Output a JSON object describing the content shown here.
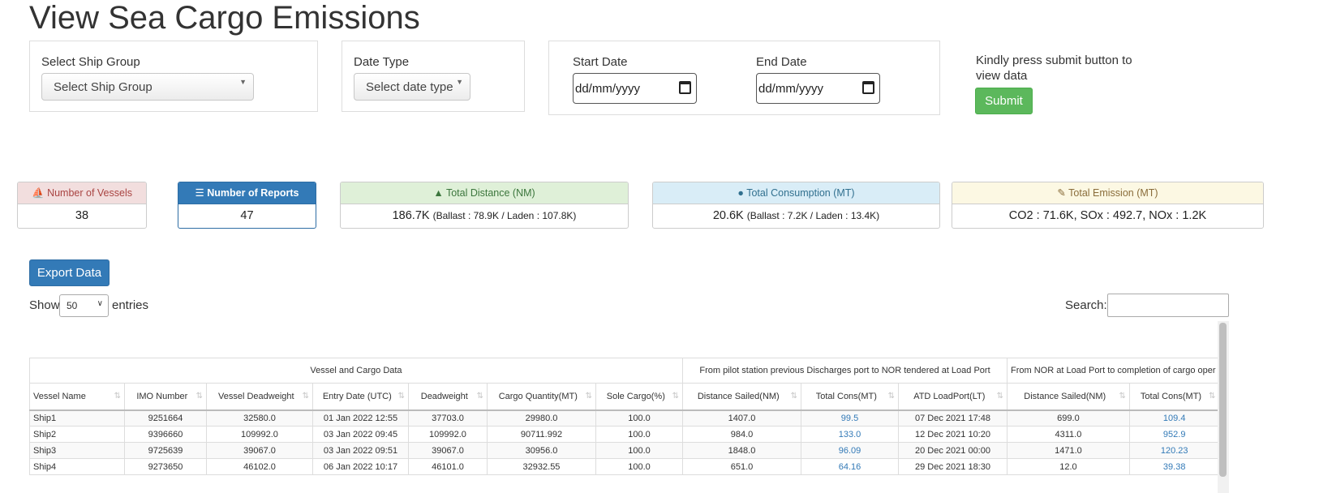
{
  "page": {
    "title": "View Sea Cargo Emissions"
  },
  "filters": {
    "ship_group": {
      "label": "Select Ship Group",
      "value": "Select Ship Group"
    },
    "date_type": {
      "label": "Date Type",
      "value": "Select date type"
    },
    "start_date": {
      "label": "Start Date",
      "placeholder": "dd/mm/yyyy"
    },
    "end_date": {
      "label": "End Date",
      "placeholder": "dd/mm/yyyy"
    },
    "note": "Kindly press submit button to view data",
    "submit_label": "Submit"
  },
  "stats": {
    "vessels": {
      "label": "Number of Vessels",
      "value": "38",
      "color": "#f2dede"
    },
    "reports": {
      "label": "Number of Reports",
      "value": "47",
      "color": "#337ab7"
    },
    "distance": {
      "label": "Total Distance (NM)",
      "value": "186.7K",
      "detail": "(Ballast : 78.9K / Laden : 107.8K)",
      "color": "#dff0d8"
    },
    "consumption": {
      "label": "Total Consumption (MT)",
      "value": "20.6K",
      "detail": "(Ballast : 7.2K / Laden : 13.4K)",
      "color": "#d9edf7"
    },
    "emission": {
      "label": "Total Emission (MT)",
      "value": "CO2 : 71.6K, SOx : 492.7, NOx : 1.2K",
      "color": "#fcf8e3"
    }
  },
  "toolbar": {
    "export_label": "Export Data",
    "show_label": "Show",
    "entries_value": "50",
    "entries_label": "entries",
    "search_label": "Search:"
  },
  "table": {
    "groups": [
      "Vessel and Cargo Data",
      "From pilot station previous Discharges port to NOR tendered at Load Port",
      "From NOR at Load Port to completion of cargo oper"
    ],
    "columns": [
      "Vessel Name",
      "IMO Number",
      "Vessel Deadweight",
      "Entry Date (UTC)",
      "Deadweight",
      "Cargo Quantity(MT)",
      "Sole Cargo(%)",
      "Distance Sailed(NM)",
      "Total Cons(MT)",
      "ATD LoadPort(LT)",
      "Distance Sailed(NM)",
      "Total Cons(MT)"
    ],
    "rows": [
      [
        "Ship1",
        "9251664",
        "32580.0",
        "01 Jan 2022 12:55",
        "37703.0",
        "29980.0",
        "100.0",
        "1407.0",
        "99.5",
        "07 Dec 2021 17:48",
        "699.0",
        "109.4"
      ],
      [
        "Ship2",
        "9396660",
        "109992.0",
        "03 Jan 2022 09:45",
        "109992.0",
        "90711.992",
        "100.0",
        "984.0",
        "133.0",
        "12 Dec 2021 10:20",
        "4311.0",
        "952.9"
      ],
      [
        "Ship3",
        "9725639",
        "39067.0",
        "03 Jan 2022 09:51",
        "39067.0",
        "30956.0",
        "100.0",
        "1848.0",
        "96.09",
        "20 Dec 2021 00:00",
        "1471.0",
        "120.23"
      ],
      [
        "Ship4",
        "9273650",
        "46102.0",
        "06 Jan 2022 10:17",
        "46101.0",
        "32932.55",
        "100.0",
        "651.0",
        "64.16",
        "29 Dec 2021 18:30",
        "12.0",
        "39.38"
      ]
    ]
  }
}
